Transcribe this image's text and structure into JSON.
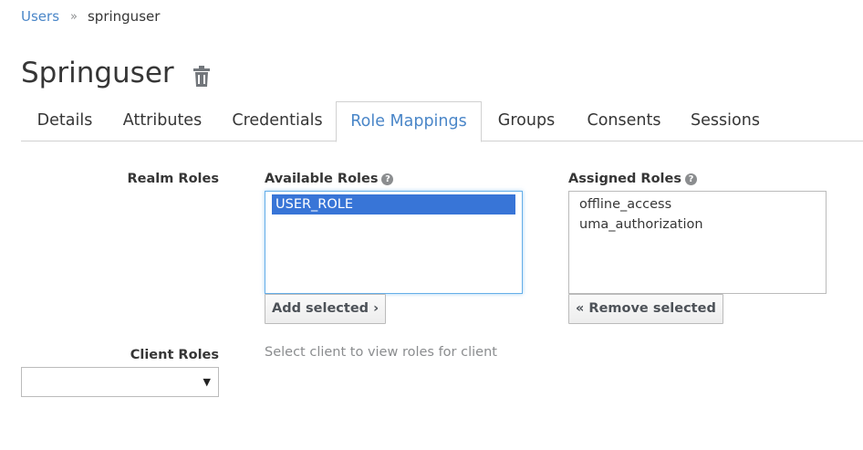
{
  "breadcrumb": {
    "parent": "Users",
    "separator": "»",
    "current": "springuser"
  },
  "page": {
    "title": "Springuser"
  },
  "tabs": [
    {
      "label": "Details",
      "active": false
    },
    {
      "label": "Attributes",
      "active": false
    },
    {
      "label": "Credentials",
      "active": false
    },
    {
      "label": "Role Mappings",
      "active": true
    },
    {
      "label": "Groups",
      "active": false
    },
    {
      "label": "Consents",
      "active": false
    },
    {
      "label": "Sessions",
      "active": false
    }
  ],
  "realm_roles": {
    "label": "Realm Roles",
    "available_heading": "Available Roles",
    "assigned_heading": "Assigned Roles",
    "available": [
      {
        "name": "USER_ROLE",
        "selected": true
      }
    ],
    "assigned": [
      {
        "name": "offline_access",
        "selected": false
      },
      {
        "name": "uma_authorization",
        "selected": false
      }
    ],
    "add_button": "Add selected ›",
    "remove_button": "« Remove selected"
  },
  "client_roles": {
    "label": "Client Roles",
    "hint": "Select client to view roles for client",
    "dropdown_value": "",
    "caret": "▼"
  },
  "help_icon_glyph": "?",
  "colors": {
    "accent": "#4a86c8",
    "selection": "#3875d7"
  }
}
